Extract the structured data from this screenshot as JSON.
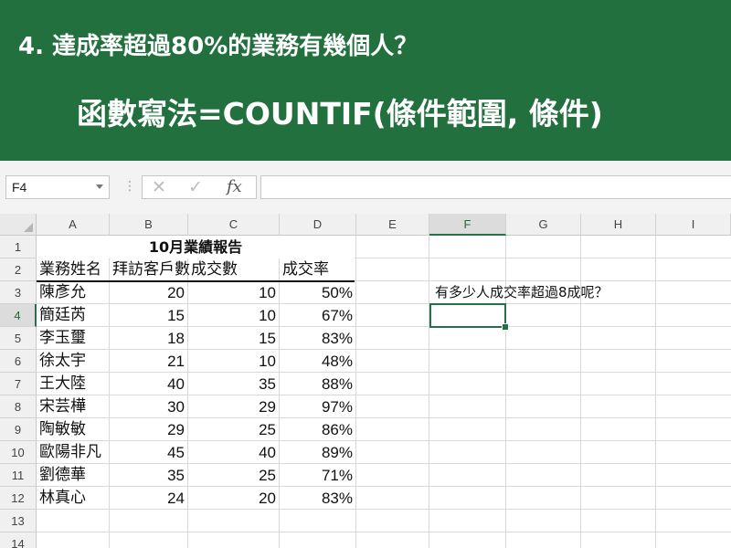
{
  "banner": {
    "question": "4. 達成率超過80%的業務有幾個人？",
    "formula": "函數寫法=COUNTIF(條件範圍, 條件)"
  },
  "formula_bar": {
    "name_box": "F4",
    "separator": "⋮",
    "cancel_symbol": "✕",
    "enter_symbol": "✓",
    "fx_symbol": "fx",
    "content": ""
  },
  "colors": {
    "banner": "#23703f",
    "accent": "#217346"
  },
  "sheet": {
    "columns": [
      "A",
      "B",
      "C",
      "D",
      "E",
      "F",
      "G",
      "H",
      "I"
    ],
    "rows": [
      "1",
      "2",
      "3",
      "4",
      "5",
      "6",
      "7",
      "8",
      "9",
      "10",
      "11",
      "12",
      "13",
      "14"
    ],
    "selected_cell": "F4",
    "title": "10月業績報告",
    "headers": [
      "業務姓名",
      "拜訪客戶數",
      "成交數",
      "成交率"
    ],
    "records": [
      [
        "陳彥允",
        "20",
        "10",
        "50%"
      ],
      [
        "簡廷芮",
        "15",
        "10",
        "67%"
      ],
      [
        "李玉璽",
        "18",
        "15",
        "83%"
      ],
      [
        "徐太宇",
        "21",
        "10",
        "48%"
      ],
      [
        "王大陸",
        "40",
        "35",
        "88%"
      ],
      [
        "宋芸樺",
        "30",
        "29",
        "97%"
      ],
      [
        "陶敏敏",
        "29",
        "25",
        "86%"
      ],
      [
        "歐陽非凡",
        "45",
        "40",
        "89%"
      ],
      [
        "劉德華",
        "35",
        "25",
        "71%"
      ],
      [
        "林真心",
        "24",
        "20",
        "83%"
      ]
    ],
    "note": "有多少人成交率超過8成呢？"
  }
}
